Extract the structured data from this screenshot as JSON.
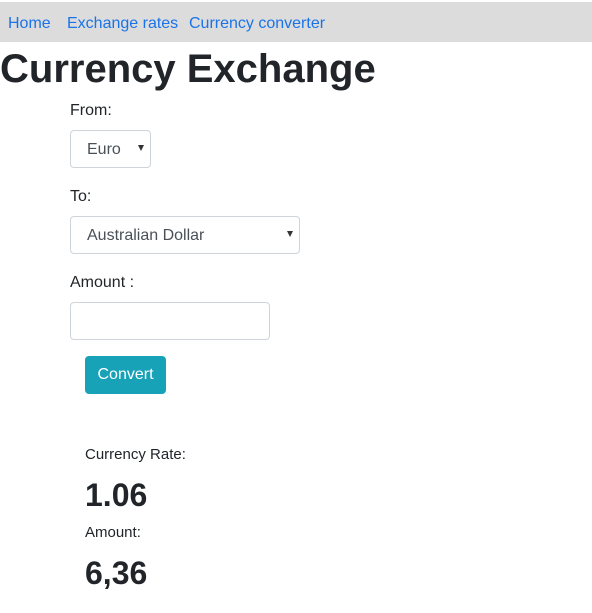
{
  "nav": {
    "items": [
      {
        "label": "Home"
      },
      {
        "label": "Exchange rates"
      },
      {
        "label": "Currency converter"
      }
    ]
  },
  "page": {
    "title": "Currency Exchange"
  },
  "form": {
    "from_label": "From:",
    "from_value": "Euro",
    "to_label": "To:",
    "to_value": "Australian Dollar",
    "amount_label": "Amount :",
    "amount_value": "",
    "convert_label": "Convert"
  },
  "result": {
    "rate_label": "Currency Rate:",
    "rate_value": "1.06",
    "amount_label": "Amount:",
    "amount_value": "6,36"
  },
  "colors": {
    "link": "#1a73e8",
    "navbar_bg": "#dcdcdc",
    "button_bg": "#17a2b8"
  }
}
